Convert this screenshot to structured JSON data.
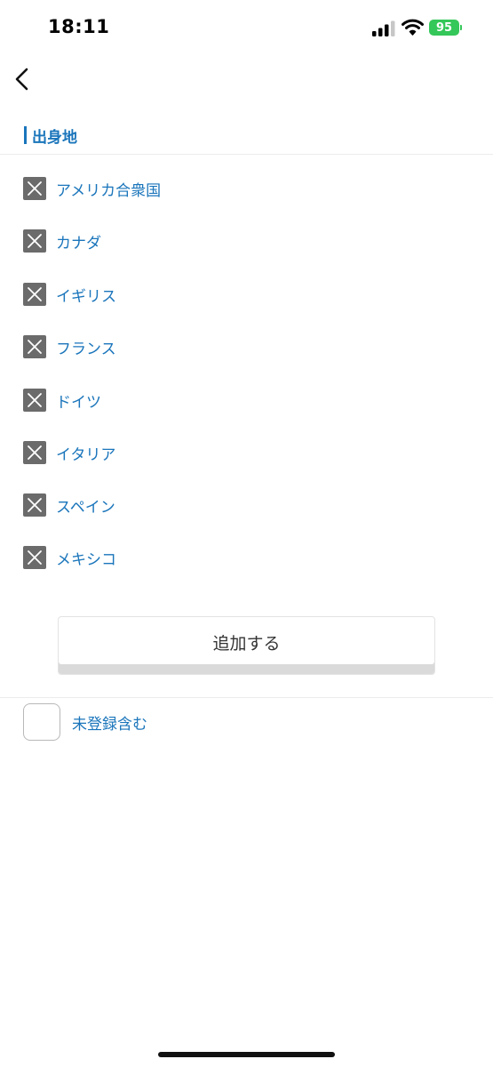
{
  "status_bar": {
    "time": "18:11",
    "battery_percent": "95",
    "battery_color": "#34c759",
    "icons": [
      "signal-icon",
      "wifi-icon",
      "battery-icon"
    ]
  },
  "nav": {
    "back_icon": "chevron-left-icon"
  },
  "section": {
    "title": "出身地",
    "accent_color": "#1a75bb"
  },
  "countries": [
    {
      "label": "アメリカ合衆国"
    },
    {
      "label": "カナダ"
    },
    {
      "label": "イギリス"
    },
    {
      "label": "フランス"
    },
    {
      "label": "ドイツ"
    },
    {
      "label": "イタリア"
    },
    {
      "label": "スペイン"
    },
    {
      "label": "メキシコ"
    }
  ],
  "remove_icon": "close-icon",
  "add_button": {
    "label": "追加する"
  },
  "unregistered": {
    "label": "未登録含む",
    "checked": false
  }
}
